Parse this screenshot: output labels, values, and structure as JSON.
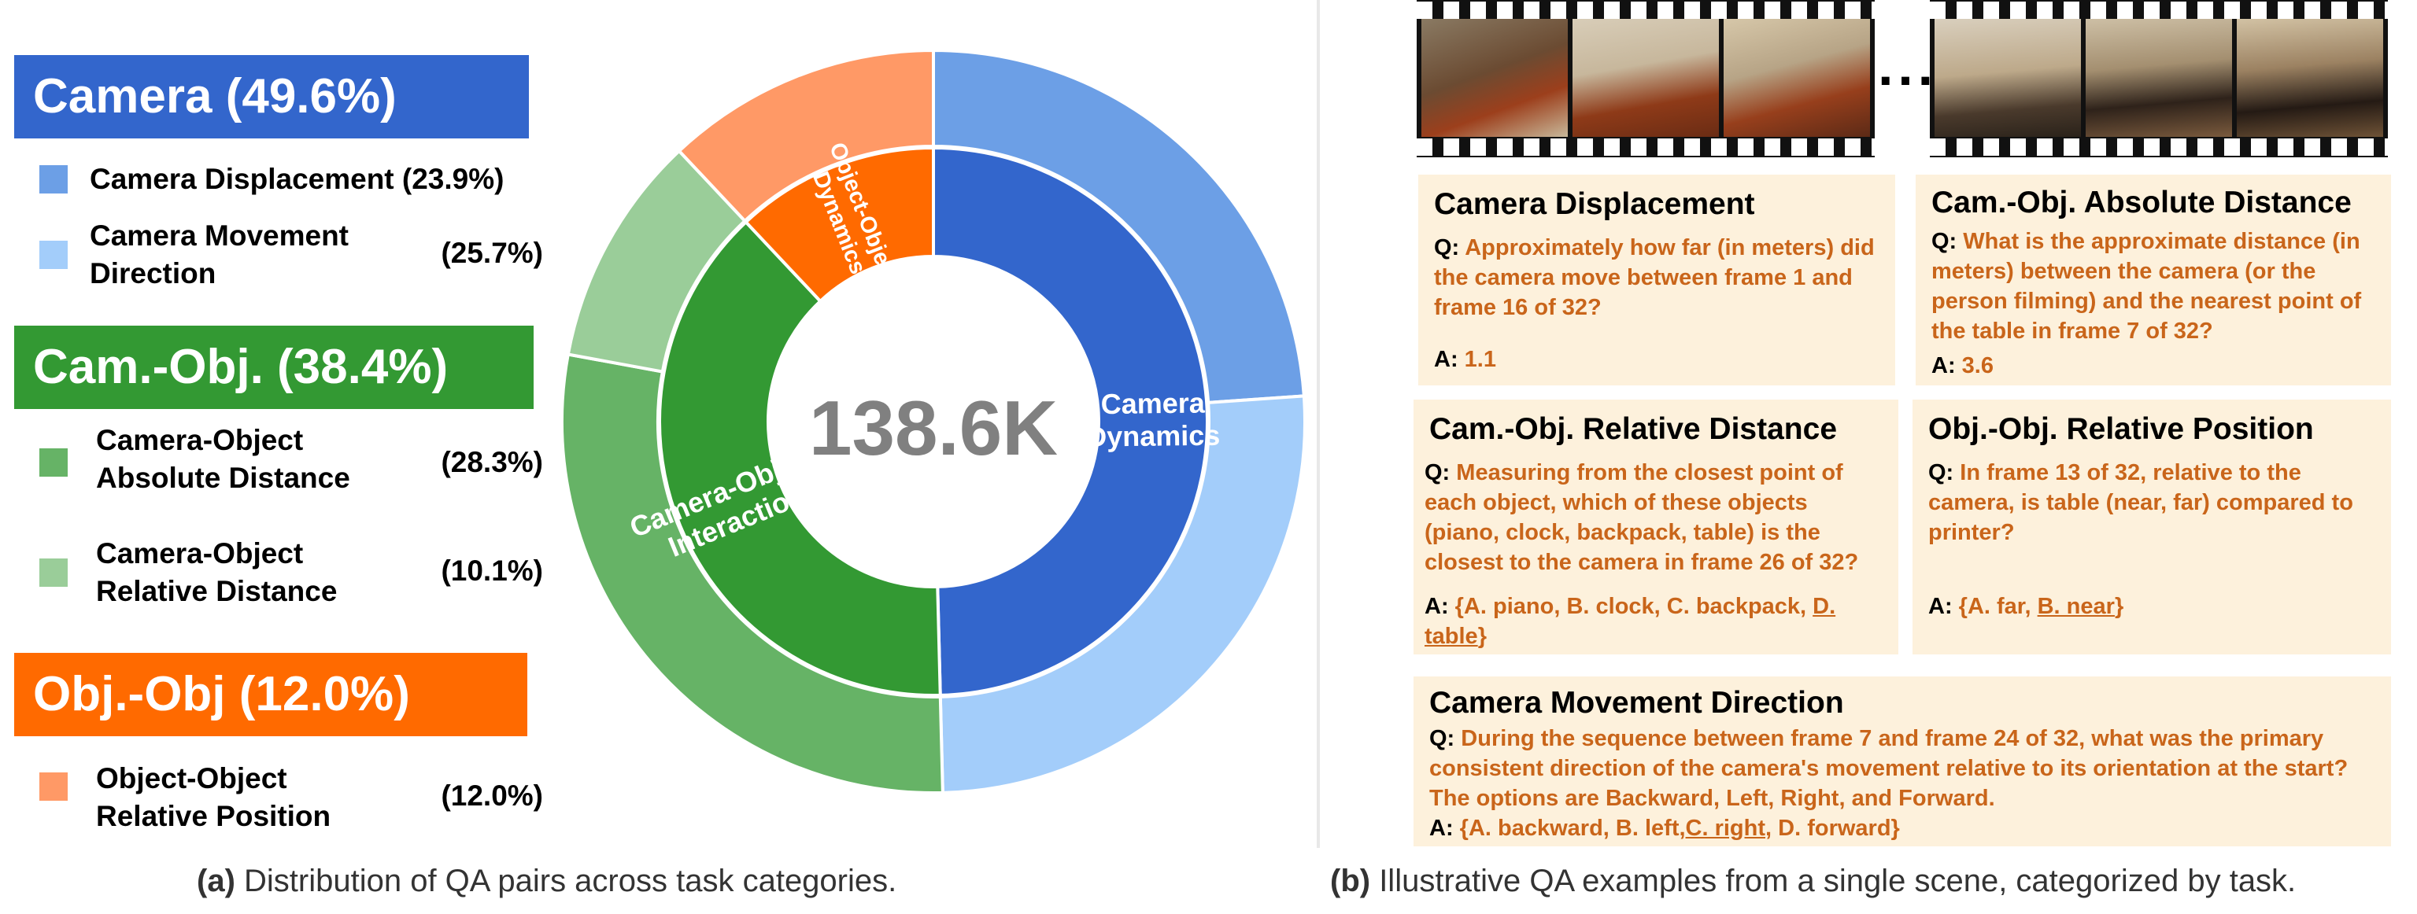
{
  "legend": {
    "camera": {
      "banner": "Camera (49.6%)",
      "color": "#3366cc",
      "items": [
        {
          "label": "Camera Displacement",
          "pct": "(23.9%)",
          "color": "#6c9fe6",
          "label_with_pct": "Camera Displacement (23.9%)"
        },
        {
          "label_line1": "Camera Movement",
          "label_line2": "Direction",
          "pct": "(25.7%)",
          "color": "#a3cdfa"
        }
      ]
    },
    "camobj": {
      "banner": "Cam.-Obj. (38.4%)",
      "color": "#339933",
      "items": [
        {
          "label_line1": "Camera-Object",
          "label_line2": "Absolute Distance",
          "pct": "(28.3%)",
          "color": "#66b366"
        },
        {
          "label_line1": "Camera-Object",
          "label_line2": "Relative Distance",
          "pct": "(10.1%)",
          "color": "#9acd99"
        }
      ]
    },
    "objobj": {
      "banner": "Obj.-Obj (12.0%)",
      "color": "#ff6a00",
      "items": [
        {
          "label_line1": "Object-Object",
          "label_line2": "Relative Position",
          "pct": "(12.0%)",
          "color": "#ff9966"
        }
      ]
    }
  },
  "chart_data": {
    "type": "pie",
    "subtype": "sunburst",
    "center_label": "138.6K",
    "inner": [
      {
        "label_line1": "Camera",
        "label_line2": "Dynamics",
        "value": 49.6,
        "color": "#3366cc"
      },
      {
        "label_line1": "Camera-Object",
        "label_line2": "Interaction",
        "value": 38.4,
        "color": "#339933"
      },
      {
        "label_line1": "Object-Object",
        "label_line2": "Dynamics",
        "value": 12.0,
        "color": "#ff6a00"
      }
    ],
    "outer": [
      {
        "label": "Camera Displacement",
        "value": 23.9,
        "color": "#6c9fe6"
      },
      {
        "label": "Camera Movement Direction",
        "value": 25.7,
        "color": "#a3cdfa"
      },
      {
        "label": "Camera-Object Absolute Distance",
        "value": 28.3,
        "color": "#66b366"
      },
      {
        "label": "Camera-Object Relative Distance",
        "value": 10.1,
        "color": "#9acd99"
      },
      {
        "label": "Object-Object Relative Position",
        "value": 12.0,
        "color": "#ff9966"
      }
    ]
  },
  "captions": {
    "a_tag": "(a)",
    "a_text": " Distribution of QA pairs across task categories.",
    "b_tag": "(b)",
    "b_text": " Illustrative QA examples from a single scene, categorized by task."
  },
  "filmstrip": {
    "ellipsis": "···"
  },
  "cards": {
    "q_prefix": "Q:",
    "a_prefix": "A:",
    "displacement": {
      "title": "Camera Displacement",
      "q": "Approximately how far (in meters) did the camera move between frame 1 and frame 16 of 32?",
      "a": "1.1"
    },
    "abs_dist": {
      "title": "Cam.-Obj. Absolute Distance",
      "q": "What is the approximate distance (in meters) between the camera (or the person filming) and the nearest point of the table in frame 7 of 32?",
      "a": "3.6"
    },
    "rel_dist": {
      "title": "Cam.-Obj. Relative Distance",
      "q": "Measuring from the closest point of each object, which of these objects (piano, clock, backpack, table) is the closest to the camera in frame 26 of 32?",
      "a_pre": "{A. piano, B. clock, C. backpack, ",
      "a_correct": "D. table",
      "a_post": "}"
    },
    "rel_pos": {
      "title": "Obj.-Obj. Relative Position",
      "q": "In frame 13 of 32, relative to the camera, is table (near, far) compared to printer?",
      "a_pre": "{A. far, ",
      "a_correct": "B. near",
      "a_post": "}"
    },
    "movement": {
      "title": "Camera Movement Direction",
      "q": "During the sequence between frame 7 and frame 24 of 32, what was the primary consistent direction of the camera's movement relative to its orientation at the start? The options are Backward, Left, Right, and Forward.",
      "a_pre": "{A. backward, B. left,",
      "a_correct": "C. right",
      "a_post": ", D. forward}"
    }
  }
}
